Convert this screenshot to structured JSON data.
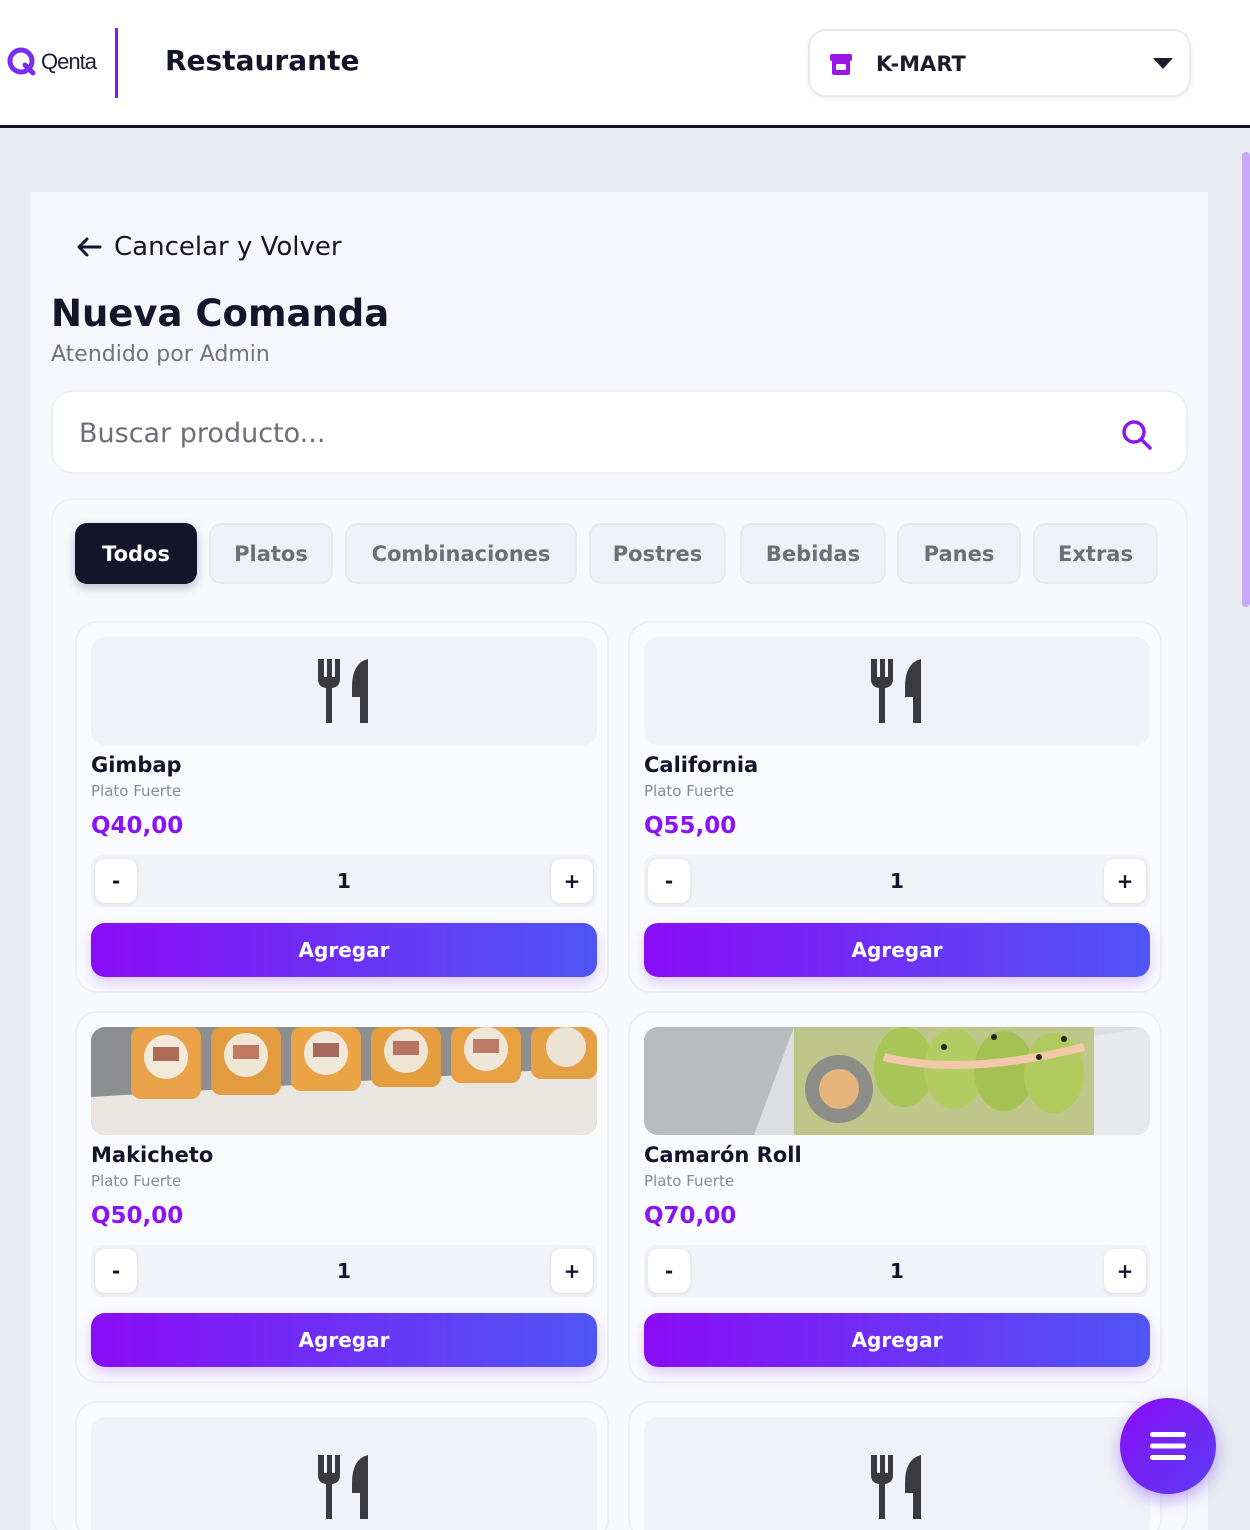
{
  "header": {
    "logo_text": "Qenta",
    "title": "Restaurante",
    "store": {
      "name": "K-MART",
      "icon": "store-icon"
    }
  },
  "nav": {
    "back_label": "Cancelar y Volver"
  },
  "page": {
    "title": "Nueva Comanda",
    "subtitle": "Atendido por Admin"
  },
  "search": {
    "placeholder": "Buscar producto...",
    "value": ""
  },
  "tabs": [
    {
      "label": "Todos",
      "active": true
    },
    {
      "label": "Platos",
      "active": false
    },
    {
      "label": "Combinaciones",
      "active": false
    },
    {
      "label": "Postres",
      "active": false
    },
    {
      "label": "Bebidas",
      "active": false
    },
    {
      "label": "Panes",
      "active": false
    },
    {
      "label": "Extras",
      "active": false
    }
  ],
  "products": [
    {
      "name": "Gimbap",
      "category": "Plato Fuerte",
      "price": "Q40,00",
      "quantity": "1",
      "image": "utensils-icon",
      "add_label": "Agregar",
      "minus": "-",
      "plus": "+"
    },
    {
      "name": "California",
      "category": "Plato Fuerte",
      "price": "Q55,00",
      "quantity": "1",
      "image": "utensils-icon",
      "add_label": "Agregar",
      "minus": "-",
      "plus": "+"
    },
    {
      "name": "Makicheto",
      "category": "Plato Fuerte",
      "price": "Q50,00",
      "quantity": "1",
      "image": "sushi-photo",
      "add_label": "Agregar",
      "minus": "-",
      "plus": "+"
    },
    {
      "name": "Camarón Roll",
      "category": "Plato Fuerte",
      "price": "Q70,00",
      "quantity": "1",
      "image": "avocado-roll-photo",
      "add_label": "Agregar",
      "minus": "-",
      "plus": "+"
    }
  ],
  "fab": {
    "icon": "menu-icon"
  },
  "colors": {
    "accent": "#8a14f5",
    "gradient_end": "#4f56f5",
    "dark": "#14142b"
  }
}
